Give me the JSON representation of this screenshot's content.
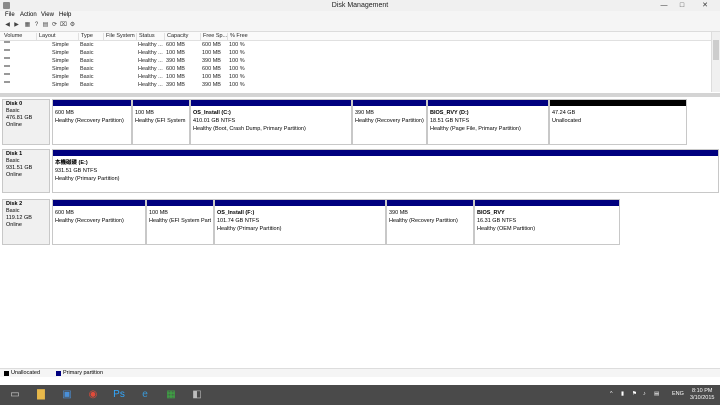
{
  "window": {
    "title": "Disk Management"
  },
  "controls": {
    "minimize": "—",
    "maximize": "□",
    "close": "✕"
  },
  "menu": [
    "File",
    "Action",
    "View",
    "Help"
  ],
  "toolbar": {
    "icons": [
      "back-icon",
      "forward-icon",
      "list-icon",
      "help-icon",
      "properties-icon",
      "refresh-icon",
      "connect-icon",
      "settings-icon"
    ],
    "glyphs": [
      "◀",
      "▶",
      "▦",
      "?",
      "▤",
      "⟳",
      "⌧",
      "⚙"
    ]
  },
  "volume_columns": [
    "Volume",
    "Layout",
    "Type",
    "File System",
    "Status",
    "Capacity",
    "Free Sp...",
    "% Free"
  ],
  "volume_rows": [
    [
      "",
      "Simple",
      "Basic",
      "",
      "Healthy ...",
      "600 MB",
      "600 MB",
      "100 %"
    ],
    [
      "",
      "Simple",
      "Basic",
      "",
      "Healthy ...",
      "100 MB",
      "100 MB",
      "100 %"
    ],
    [
      "",
      "Simple",
      "Basic",
      "",
      "Healthy ...",
      "390 MB",
      "390 MB",
      "100 %"
    ],
    [
      "",
      "Simple",
      "Basic",
      "",
      "Healthy ...",
      "600 MB",
      "600 MB",
      "100 %"
    ],
    [
      "",
      "Simple",
      "Basic",
      "",
      "Healthy ...",
      "100 MB",
      "100 MB",
      "100 %"
    ],
    [
      "",
      "Simple",
      "Basic",
      "",
      "Healthy ...",
      "390 MB",
      "390 MB",
      "100 %"
    ]
  ],
  "disks": [
    {
      "name": "Disk 0",
      "type": "Basic",
      "size": "476.81 GB",
      "status": "Online",
      "partitions": [
        {
          "name": "",
          "size": "600 MB",
          "status": "Healthy (Recovery Partition)",
          "bar": "primary"
        },
        {
          "name": "",
          "size": "100 MB",
          "status": "Healthy (EFI System P",
          "bar": "primary"
        },
        {
          "name": "OS_Install  (C:)",
          "size": "410.01 GB NTFS",
          "status": "Healthy (Boot, Crash Dump, Primary Partition)",
          "bar": "primary"
        },
        {
          "name": "",
          "size": "390 MB",
          "status": "Healthy (Recovery Partition)",
          "bar": "primary"
        },
        {
          "name": "BIOS_RVY  (D:)",
          "size": "18.51 GB NTFS",
          "status": "Healthy (Page File, Primary Partition)",
          "bar": "primary"
        },
        {
          "name": "",
          "size": "47.24 GB",
          "status": "Unallocated",
          "bar": "unallocated"
        }
      ]
    },
    {
      "name": "Disk 1",
      "type": "Basic",
      "size": "931.51 GB",
      "status": "Online",
      "partitions": [
        {
          "name": "本機磁碟  (E:)",
          "size": "931.51 GB NTFS",
          "status": "Healthy (Primary Partition)",
          "bar": "primary"
        }
      ]
    },
    {
      "name": "Disk 2",
      "type": "Basic",
      "size": "119.12 GB",
      "status": "Online",
      "partitions": [
        {
          "name": "",
          "size": "600 MB",
          "status": "Healthy (Recovery Partition)",
          "bar": "primary"
        },
        {
          "name": "",
          "size": "100 MB",
          "status": "Healthy (EFI System Parti",
          "bar": "primary"
        },
        {
          "name": "OS_Install  (F:)",
          "size": "101.74 GB NTFS",
          "status": "Healthy (Primary Partition)",
          "bar": "primary"
        },
        {
          "name": "",
          "size": "390 MB",
          "status": "Healthy (Recovery Partition)",
          "bar": "primary"
        },
        {
          "name": "BIOS_RVY",
          "size": "16.31 GB NTFS",
          "status": "Healthy (OEM Partition)",
          "bar": "primary"
        }
      ]
    }
  ],
  "legend": [
    {
      "label": "Unallocated",
      "color": "#000000"
    },
    {
      "label": "Primary partition",
      "color": "#00007f"
    }
  ],
  "taskbar": {
    "apps": [
      {
        "name": "desktop-icon",
        "glyph": "▭",
        "color": "#d0d0d0"
      },
      {
        "name": "file-explorer-icon",
        "glyph": "▇",
        "color": "#e8b84a"
      },
      {
        "name": "powershell-icon",
        "glyph": "▣",
        "color": "#4a90d9"
      },
      {
        "name": "chrome-icon",
        "glyph": "◉",
        "color": "#e04b3a"
      },
      {
        "name": "photoshop-icon",
        "glyph": "Ps",
        "color": "#31a8ff"
      },
      {
        "name": "internet-explorer-icon",
        "glyph": "e",
        "color": "#3a9ad9"
      },
      {
        "name": "store-icon",
        "glyph": "▦",
        "color": "#3cb043"
      },
      {
        "name": "disk-management-icon",
        "glyph": "◧",
        "color": "#bdbdbd"
      }
    ],
    "tray_icons": [
      "^",
      "▮",
      "⚑",
      "♪",
      "▤"
    ],
    "language": "ENG",
    "time": "8:10 PM",
    "date": "3/10/2015"
  }
}
